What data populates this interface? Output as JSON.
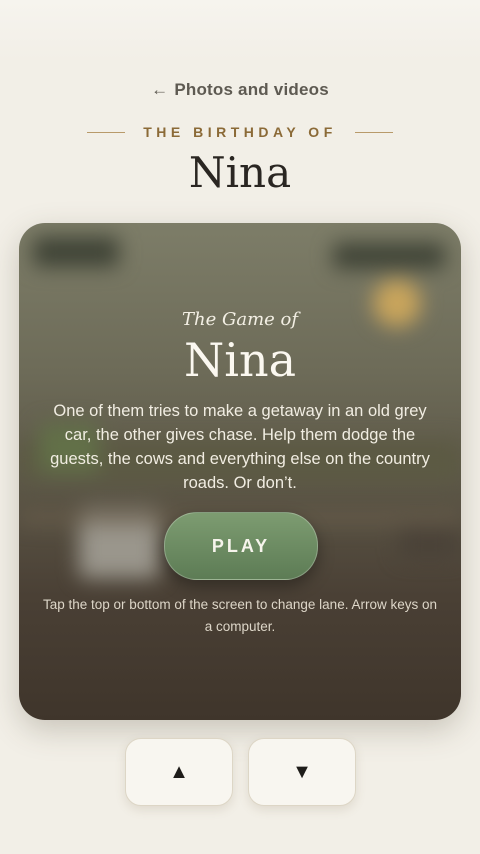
{
  "nav": {
    "back_label": "Photos and videos",
    "back_icon": "arrow-left-icon"
  },
  "header": {
    "eyebrow": "THE BIRTHDAY OF",
    "title": "Nina"
  },
  "game": {
    "subtitle": "The Game of",
    "title": "Nina",
    "description": "One of them tries to make a getaway in an old grey car, the other gives chase. Help them dodge the guests, the cows and everything else on the country roads. Or don’t.",
    "play_label": "PLAY",
    "hint": "Tap the top or bottom of the screen to change lane. Arrow keys on a computer."
  },
  "controls": {
    "up_glyph": "▲",
    "down_glyph": "▼"
  },
  "colors": {
    "background": "#f2efe7",
    "accent": "#8b6a37",
    "play_button": "#6b8a60"
  }
}
